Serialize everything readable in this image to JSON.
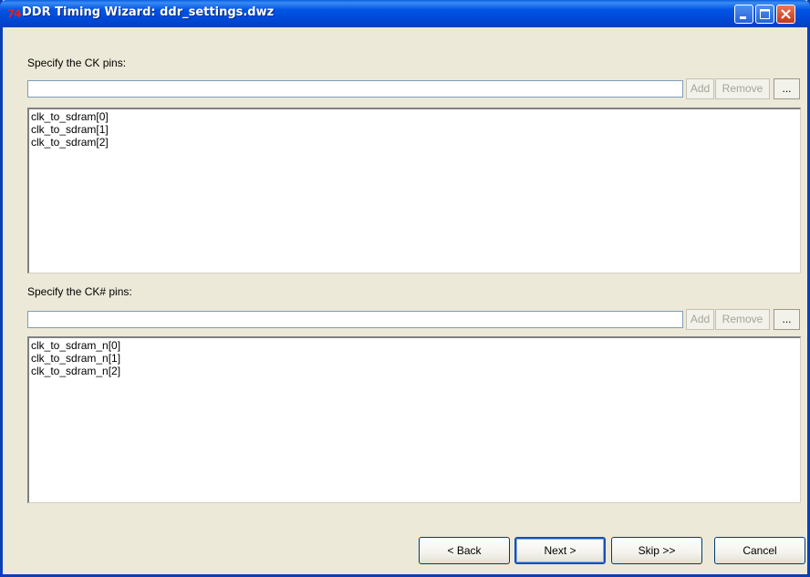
{
  "window": {
    "title": "DDR Timing Wizard: ddr_settings.dwz",
    "app_icon": "74"
  },
  "ck_section": {
    "label": "Specify the CK pins:",
    "input_value": "",
    "add_label": "Add",
    "remove_label": "Remove",
    "browse_label": "...",
    "items": [
      "clk_to_sdram[0]",
      "clk_to_sdram[1]",
      "clk_to_sdram[2]"
    ]
  },
  "ckn_section": {
    "label": "Specify the CK# pins:",
    "input_value": "",
    "add_label": "Add",
    "remove_label": "Remove",
    "browse_label": "...",
    "items": [
      "clk_to_sdram_n[0]",
      "clk_to_sdram_n[1]",
      "clk_to_sdram_n[2]"
    ]
  },
  "nav": {
    "back_label": "< Back",
    "next_label": "Next >",
    "skip_label": "Skip >>",
    "cancel_label": "Cancel"
  },
  "colors": {
    "titlebar": "#0055e5",
    "dialog_bg": "#ece9d8",
    "icon_red": "#e8201a"
  },
  "icons": [
    "app-icon",
    "minimize-icon",
    "maximize-icon",
    "close-icon"
  ]
}
